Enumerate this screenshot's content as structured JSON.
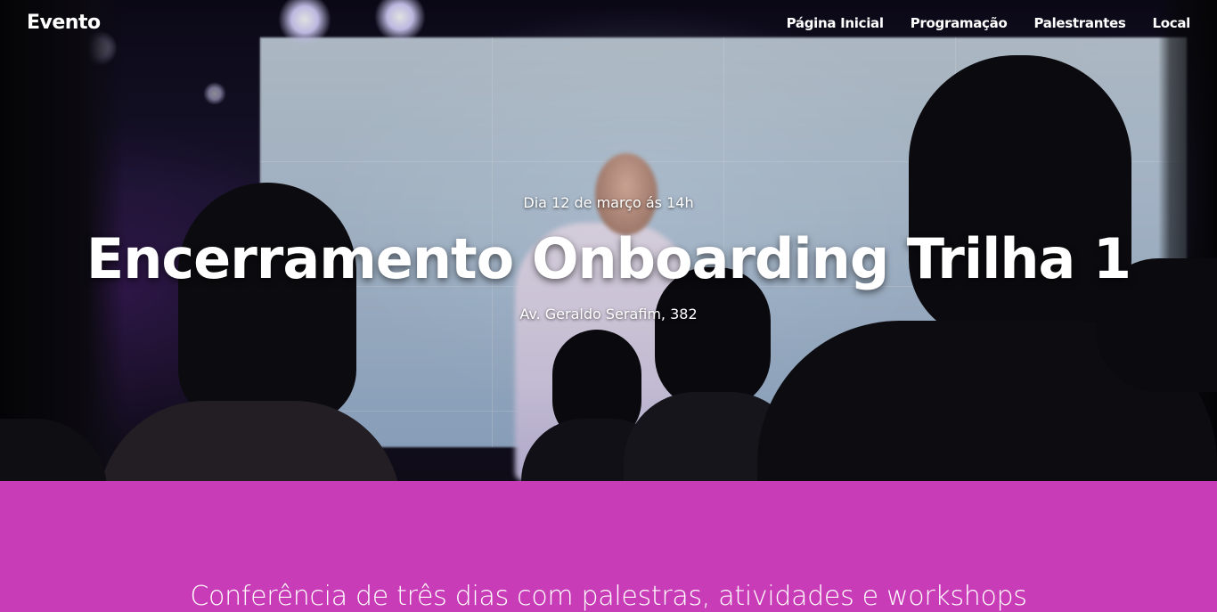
{
  "navbar": {
    "brand": "Evento",
    "links": [
      {
        "label": "Página Inicial"
      },
      {
        "label": "Programação"
      },
      {
        "label": "Palestrantes"
      },
      {
        "label": "Local"
      }
    ]
  },
  "hero": {
    "date": "Dia 12 de março ás 14h",
    "title": "Encerramento Onboarding Trilha 1",
    "address": "Av. Geraldo Serafim, 382"
  },
  "about": {
    "text": "Conferência de três dias com palestras, atividades e workshops"
  },
  "colors": {
    "accent": "#c93cb8",
    "text": "#ffffff"
  }
}
